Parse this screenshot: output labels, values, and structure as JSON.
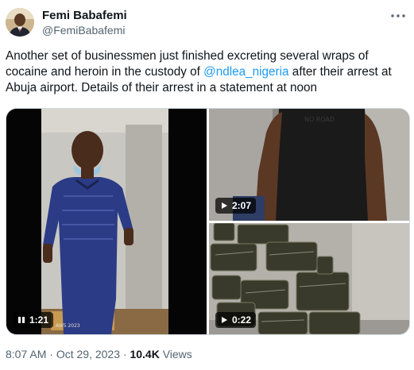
{
  "author": {
    "display_name": "Femi Babafemi",
    "handle": "@FemiBabafemi"
  },
  "tweet": {
    "text_before": "Another set of businessmen just finished excreting several wraps of cocaine and heroin in the custody of ",
    "mention": "@ndlea_nigeria",
    "text_after": " after their arrest at Abuja airport. Details of their arrest in a statement at noon"
  },
  "media": {
    "video_left": {
      "state_icon": "pause-icon",
      "duration": "1:21"
    },
    "video_top_right": {
      "state_icon": "play-icon",
      "duration": "2:07"
    },
    "video_bottom_right": {
      "state_icon": "play-icon",
      "duration": "0:22"
    }
  },
  "footer": {
    "time": "8:07 AM",
    "separator": "·",
    "date": "Oct 29, 2023",
    "views_count": "10.4K",
    "views_label": "Views"
  },
  "colors": {
    "link": "#1d9bf0",
    "secondary_text": "#536471",
    "primary_text": "#0f1419"
  }
}
